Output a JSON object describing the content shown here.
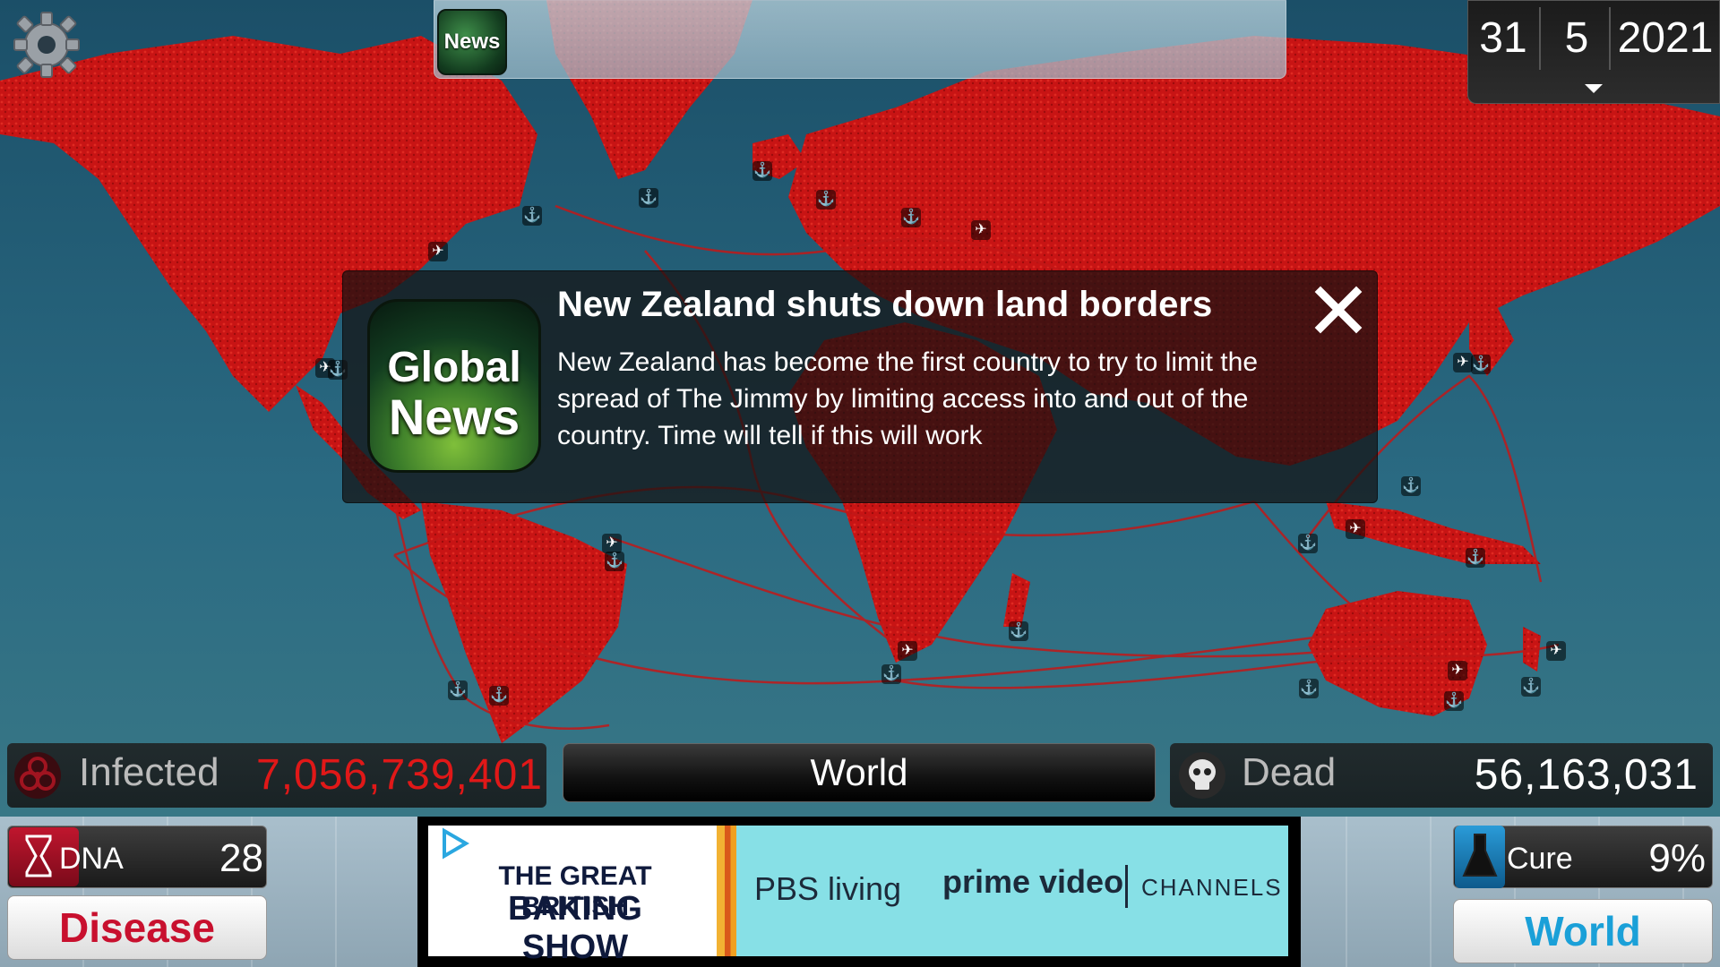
{
  "ticker": {
    "news_label": "News"
  },
  "date": {
    "day": "31",
    "month": "5",
    "year": "2021",
    "toggle_icon": "chevron-down-icon"
  },
  "popup": {
    "logo_line1": "Global",
    "logo_line2": "News",
    "title": "New Zealand shuts down land borders",
    "body": "New Zealand has become the first country to try to limit the spread of The Jimmy by limiting access into and out of the country. Time will tell if this will work"
  },
  "stats": {
    "infected_label": "Infected",
    "infected_value": "7,056,739,401",
    "region_button": "World",
    "dead_label": "Dead",
    "dead_value": "56,163,031"
  },
  "dna": {
    "label": "DNA",
    "value": "28"
  },
  "disease_button": "Disease",
  "cure": {
    "label": "Cure",
    "value": "9%"
  },
  "world_button": "World",
  "ad": {
    "line1": "THE GREAT BRITISH",
    "line2": "BAKING SHOW",
    "pbs": "PBS living",
    "prime": "prime video",
    "channels": "CHANNELS"
  },
  "colors": {
    "infected": "#e01818",
    "disease": "#c8102e",
    "world_link": "#1aa0d8",
    "ocean": "#1f5f78",
    "land": "#c81414"
  }
}
